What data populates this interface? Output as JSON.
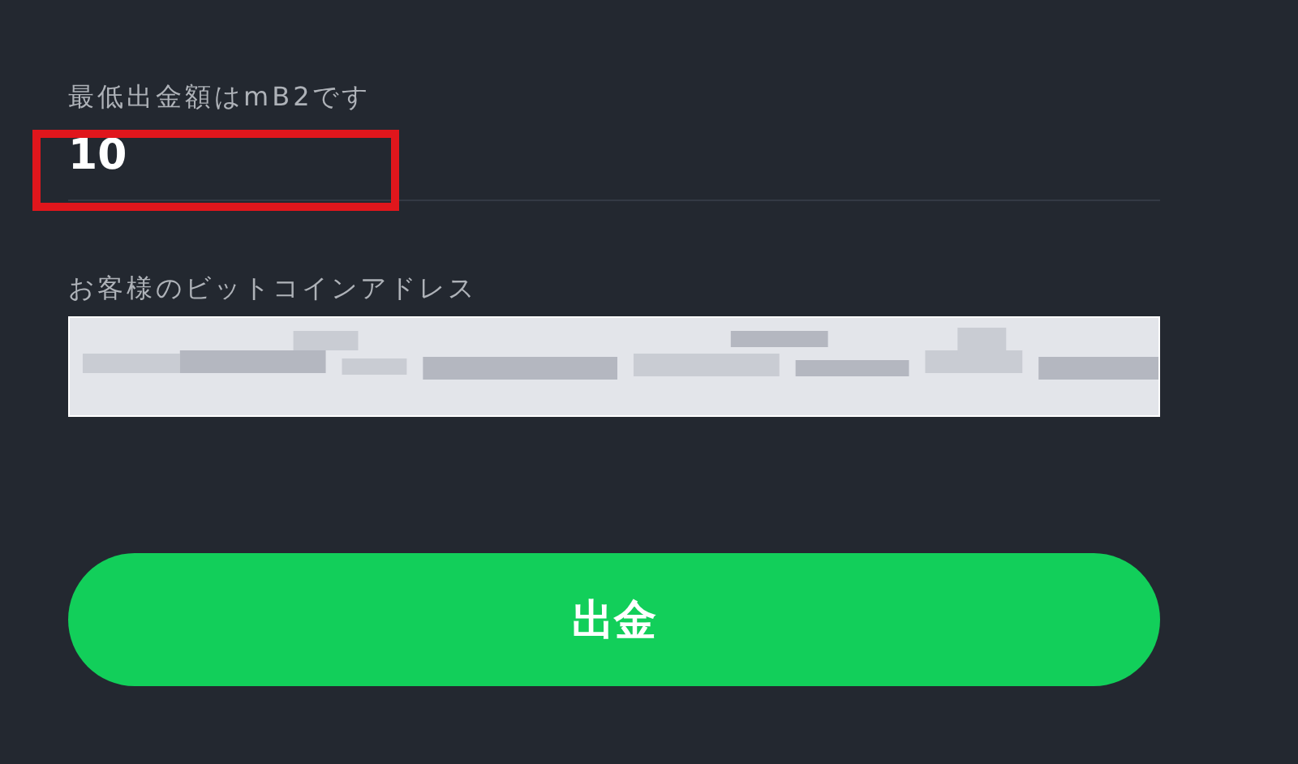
{
  "amount_field": {
    "label": "最低出金額はmB2です",
    "value": "10",
    "highlighted": true
  },
  "address_field": {
    "label": "お客様のビットコインアドレス",
    "redacted": true
  },
  "submit_button": {
    "label": "出金"
  }
}
